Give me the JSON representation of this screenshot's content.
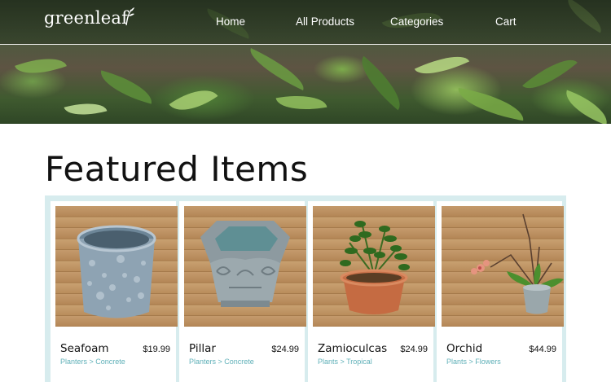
{
  "brand": {
    "logo_text": "greenleaf"
  },
  "nav": {
    "items": [
      {
        "label": "Home"
      },
      {
        "label": "All Products"
      },
      {
        "label": "Categories"
      },
      {
        "label": "Cart"
      }
    ]
  },
  "featured": {
    "title": "Featured Items",
    "products": [
      {
        "name": "Seafoam",
        "price": "$19.99",
        "category": "Planters > Concrete"
      },
      {
        "name": "Pillar",
        "price": "$24.99",
        "category": "Planters > Concrete"
      },
      {
        "name": "Zamioculcas",
        "price": "$24.99",
        "category": "Plants > Tropical"
      },
      {
        "name": "Orchid",
        "price": "$44.99",
        "category": "Plants > Flowers"
      }
    ]
  },
  "colors": {
    "accent": "#5fb0b8",
    "grid_background": "#d7ecee"
  }
}
